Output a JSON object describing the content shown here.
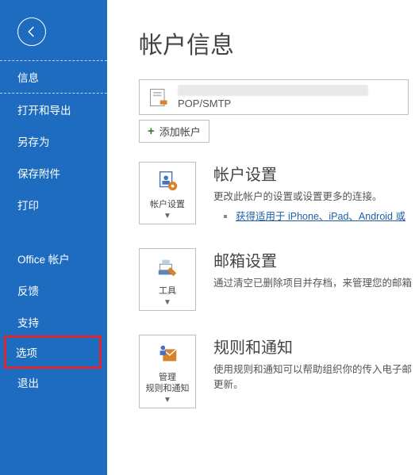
{
  "sidebar": {
    "items": [
      {
        "label": "信息"
      },
      {
        "label": "打开和导出"
      },
      {
        "label": "另存为"
      },
      {
        "label": "保存附件"
      },
      {
        "label": "打印"
      },
      {
        "label": "Office 帐户"
      },
      {
        "label": "反馈"
      },
      {
        "label": "支持"
      },
      {
        "label": "选项"
      },
      {
        "label": "退出"
      }
    ]
  },
  "main": {
    "title": "帐户信息",
    "account_type": "POP/SMTP",
    "add_account": "添加帐户",
    "sections": [
      {
        "tile_label": "帐户设置",
        "heading": "帐户设置",
        "desc": "更改此帐户的设置或设置更多的连接。",
        "link": "获得适用于 iPhone、iPad、Android 或"
      },
      {
        "tile_label": "工具",
        "heading": "邮箱设置",
        "desc": "通过清空已删除项目并存档，来管理您的邮箱"
      },
      {
        "tile_label": "管理\n规则和通知",
        "heading": "规则和通知",
        "desc": "使用规则和通知可以帮助组织你的传入电子邮件，并在项目添加、更改或删除时收到更新。",
        "desc_cut": "使用规则和通知可以帮助组织你的传入电子邮"
      }
    ],
    "update_word": "更新。"
  }
}
